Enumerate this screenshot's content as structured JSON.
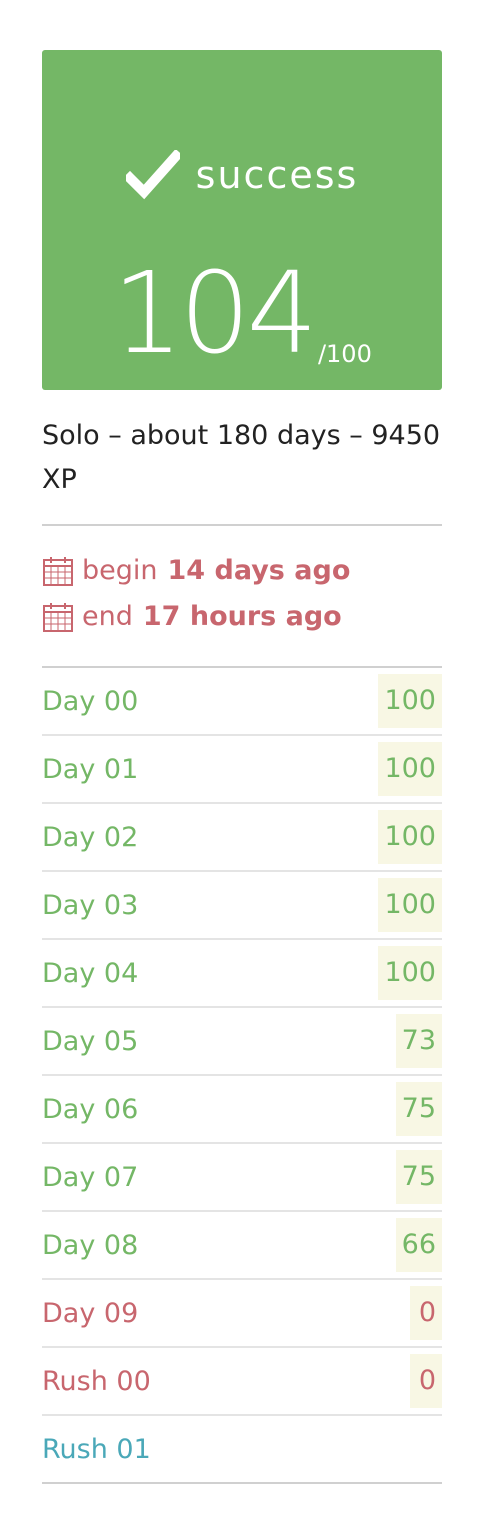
{
  "status": {
    "label": "success",
    "grade": "104",
    "max": "/100",
    "icon": "checkmark-icon",
    "color": "#74b766"
  },
  "summary": {
    "text": "Solo – about 180 days – 9450 XP"
  },
  "dates": {
    "begin_label": "begin",
    "begin_value": "14 days ago",
    "end_label": "end",
    "end_value": "17 hours ago",
    "icon": "calendar-icon",
    "color": "#c8666e"
  },
  "rows": [
    {
      "name": "Day 00",
      "score": "100",
      "status": "green"
    },
    {
      "name": "Day 01",
      "score": "100",
      "status": "green"
    },
    {
      "name": "Day 02",
      "score": "100",
      "status": "green"
    },
    {
      "name": "Day 03",
      "score": "100",
      "status": "green"
    },
    {
      "name": "Day 04",
      "score": "100",
      "status": "green"
    },
    {
      "name": "Day 05",
      "score": "73",
      "status": "green"
    },
    {
      "name": "Day 06",
      "score": "75",
      "status": "green"
    },
    {
      "name": "Day 07",
      "score": "75",
      "status": "green"
    },
    {
      "name": "Day 08",
      "score": "66",
      "status": "green"
    },
    {
      "name": "Day 09",
      "score": "0",
      "status": "red"
    },
    {
      "name": "Rush 00",
      "score": "0",
      "status": "red"
    },
    {
      "name": "Rush 01",
      "score": "",
      "status": "blue"
    }
  ]
}
